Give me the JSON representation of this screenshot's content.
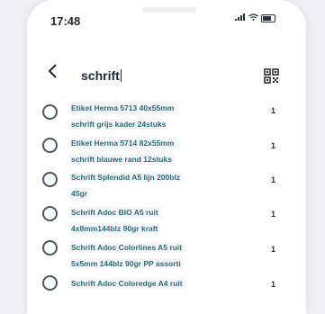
{
  "status": {
    "time": "17:48"
  },
  "search": {
    "query": "schrift"
  },
  "items": [
    {
      "line1": "Etiket Herma 5713 40x55mm",
      "line2": "schrift grijs kader 24stuks",
      "qty": "1"
    },
    {
      "line1": "Etiket Herma 5714 82x55mm",
      "line2": "schrift blauwe rand 12stuks",
      "qty": "1"
    },
    {
      "line1": "Schrift Splendid A5 lijn 200blz",
      "line2": "45gr",
      "qty": "1"
    },
    {
      "line1": "Schrift Adoc BIO A5 ruit",
      "line2": "4x8mm144blz 90gr kraft",
      "qty": "1"
    },
    {
      "line1": "Schrift Adoc Colorlines A5 ruit",
      "line2": "5x5mm 144blz 90gr PP assorti",
      "qty": "1"
    },
    {
      "line1": "Schrift Adoc Coloredge A4 ruit",
      "line2": "",
      "qty": "1"
    }
  ]
}
